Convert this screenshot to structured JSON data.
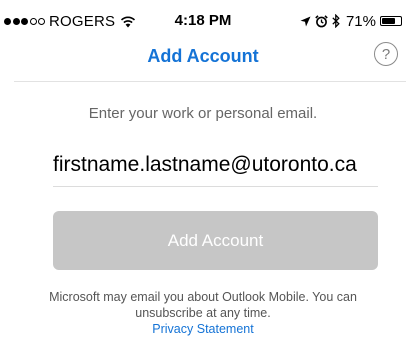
{
  "status_bar": {
    "carrier": "ROGERS",
    "time": "4:18 PM",
    "battery_percent": "71%",
    "battery_level": 0.71,
    "signal_bars_filled": 3,
    "signal_bars_total": 5
  },
  "nav": {
    "title": "Add Account",
    "help_symbol": "?"
  },
  "form": {
    "instruction": "Enter your work or personal email.",
    "email_value": "firstname.lastname@utoronto.ca",
    "add_button_label": "Add Account"
  },
  "footer": {
    "disclaimer_line1": "Microsoft may email you about Outlook Mobile. You can",
    "disclaimer_line2": "unsubscribe at any time.",
    "privacy_link": "Privacy Statement"
  },
  "colors": {
    "accent": "#1473d6",
    "button_disabled": "#c6c6c6",
    "instruction_text": "#666666"
  },
  "icons": {
    "wifi": "wifi-icon",
    "location": "location-arrow-icon",
    "alarm": "alarm-clock-icon",
    "bluetooth": "bluetooth-icon",
    "battery": "battery-icon",
    "help": "help-icon"
  }
}
